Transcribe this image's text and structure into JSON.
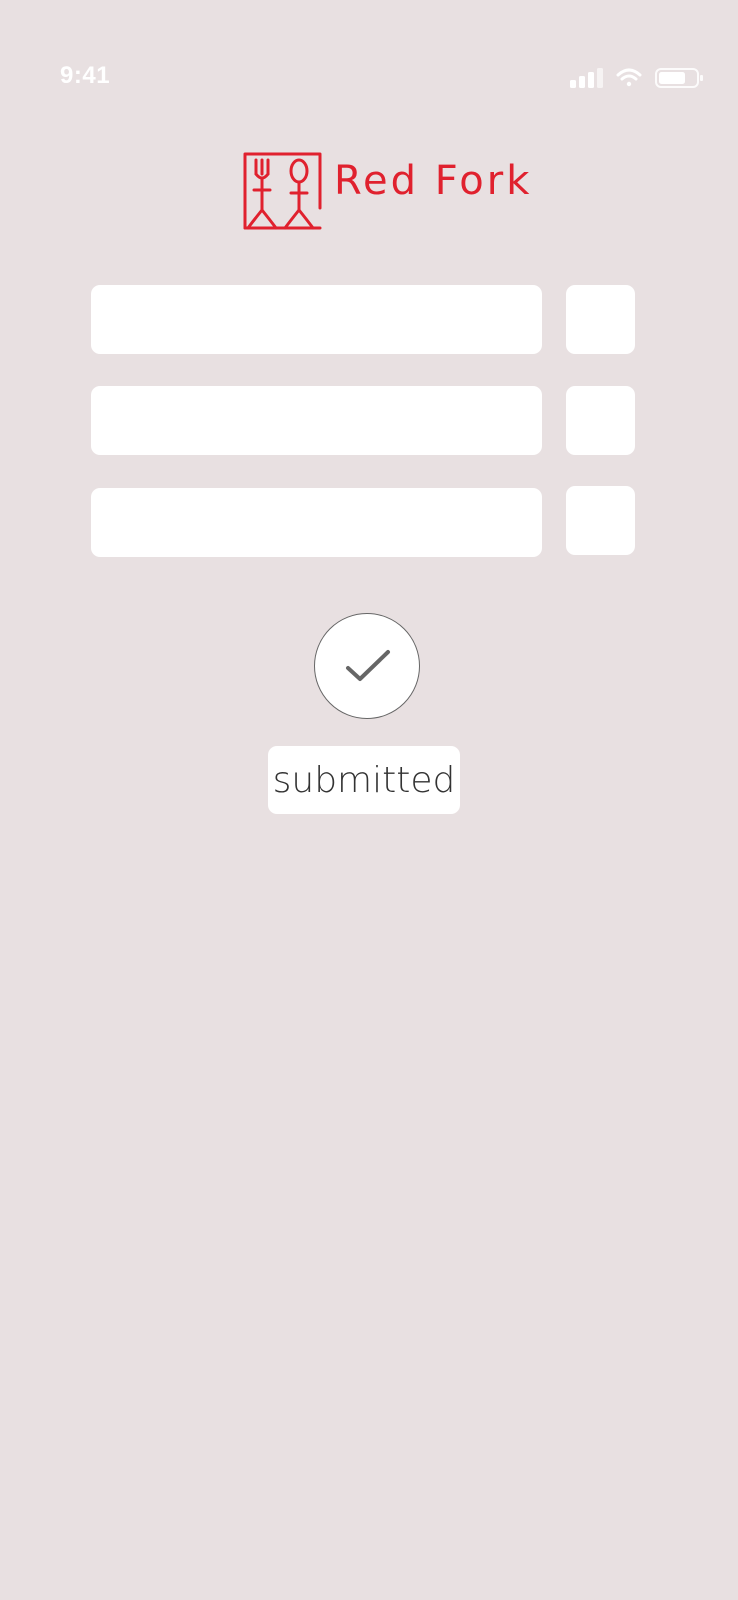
{
  "status_bar": {
    "time": "9:41",
    "icons": [
      "cellular-signal-icon",
      "wifi-icon",
      "battery-icon"
    ]
  },
  "logo": {
    "brand_name": "Red Fork",
    "icon": "fork-and-spoon-figures-icon",
    "color": "#e0212e"
  },
  "form": {
    "rows": [
      {
        "text_value": "",
        "small_value": ""
      },
      {
        "text_value": "",
        "small_value": ""
      },
      {
        "text_value": "",
        "small_value": ""
      }
    ]
  },
  "submit": {
    "icon": "checkmark-icon",
    "status_label": "submitted"
  },
  "colors": {
    "background": "#e8e0e1",
    "accent": "#e0212e",
    "field": "#ffffff"
  }
}
